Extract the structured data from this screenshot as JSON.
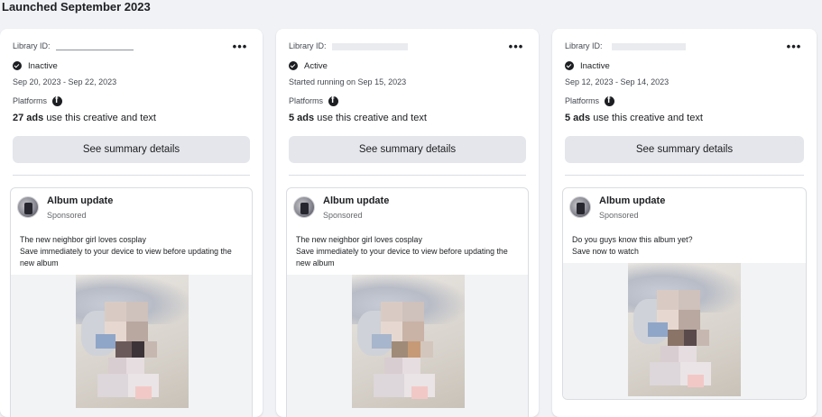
{
  "section_title": "Launched September 2023",
  "cards": [
    {
      "library_label": "Library ID:",
      "status": "Inactive",
      "date_text": "Sep 20, 2023 - Sep 22, 2023",
      "platforms_label": "Platforms",
      "ads_count": "27 ads",
      "ads_suffix": "use this creative and text",
      "summary_label": "See summary details",
      "more_label": "•••",
      "page_name": "Album update",
      "sponsored": "Sponsored",
      "body_lines": [
        "The new neighbor girl loves cosplay",
        "Save immediately to your device to view before updating the new album"
      ]
    },
    {
      "library_label": "Library ID:",
      "status": "Active",
      "date_text": "Started running on Sep 15, 2023",
      "platforms_label": "Platforms",
      "ads_count": "5 ads",
      "ads_suffix": "use this creative and text",
      "summary_label": "See summary details",
      "more_label": "•••",
      "page_name": "Album update",
      "sponsored": "Sponsored",
      "body_lines": [
        "The new neighbor girl loves cosplay",
        "Save immediately to your device to view before updating the new album"
      ]
    },
    {
      "library_label": "Library ID: ",
      "status": "Inactive",
      "date_text": "Sep 12, 2023 - Sep 14, 2023",
      "platforms_label": "Platforms",
      "ads_count": "5 ads",
      "ads_suffix": "use this creative and text",
      "summary_label": "See summary details",
      "more_label": "•••",
      "page_name": "Album update",
      "sponsored": "Sponsored",
      "body_lines": [
        "Do you guys know this album yet?",
        "Save now to watch"
      ]
    }
  ],
  "icons": {
    "status": "check-circle-icon",
    "platform": "facebook-icon",
    "more": "more-horizontal-icon"
  },
  "colors": {
    "background": "#f0f2f5",
    "card": "#ffffff",
    "button": "#e4e6eb",
    "text": "#1c1e21",
    "secondary_text": "#65676b"
  }
}
